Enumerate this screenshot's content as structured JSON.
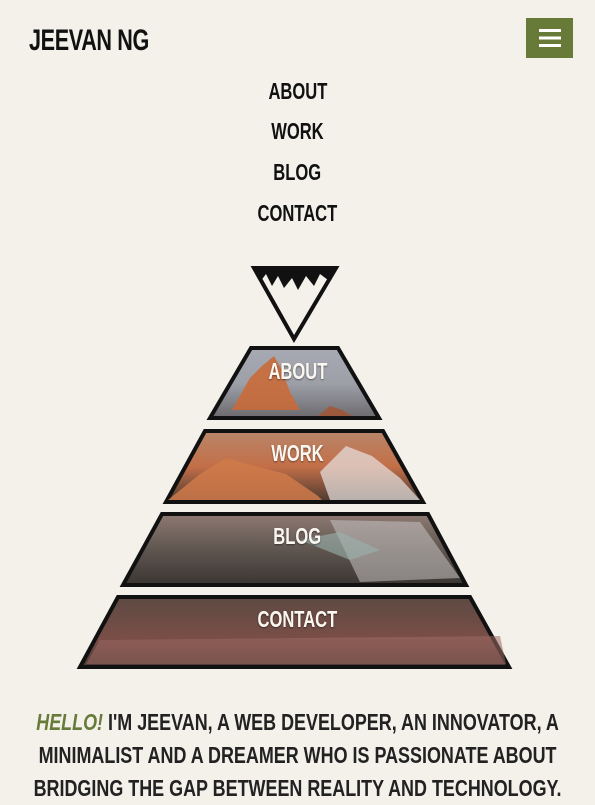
{
  "header": {
    "brand": "JEEVAN NG",
    "menu_icon": "hamburger-icon"
  },
  "nav": {
    "items": [
      {
        "label": "ABOUT"
      },
      {
        "label": "WORK"
      },
      {
        "label": "BLOG"
      },
      {
        "label": "CONTACT"
      }
    ]
  },
  "pyramid": {
    "logo_icon": "mountain-peak-icon",
    "tiers": [
      {
        "label": "ABOUT"
      },
      {
        "label": "WORK"
      },
      {
        "label": "BLOG"
      },
      {
        "label": "CONTACT"
      }
    ]
  },
  "intro": {
    "hello": "HELLO!",
    "text": "I'M JEEVAN, A WEB DEVELOPER, AN INNOVATOR, A MINIMALIST AND A DREAMER WHO IS PASSIONATE ABOUT BRIDGING THE GAP BETWEEN REALITY AND TECHNOLOGY."
  },
  "colors": {
    "background": "#f4f1eb",
    "accent": "#687a38",
    "text": "#111111"
  }
}
